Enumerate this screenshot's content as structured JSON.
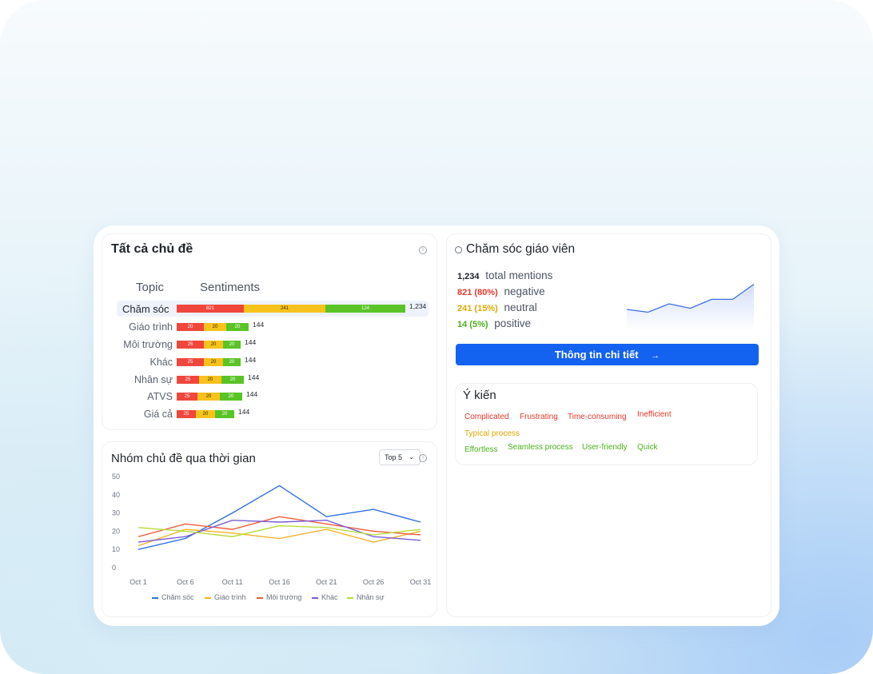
{
  "topics_card": {
    "title": "Tất cả chủ đề",
    "col_topic": "Topic",
    "col_sentiments": "Sentiments",
    "rows": [
      {
        "label": "Chăm sóc",
        "neg": "821",
        "neu": "241",
        "pos": "124",
        "total": "1,234",
        "selected": true
      },
      {
        "label": "Giáo trình",
        "neg": "20",
        "neu": "20",
        "pos": "20",
        "total": "144"
      },
      {
        "label": "Môi trường",
        "neg": "25",
        "neu": "20",
        "pos": "20",
        "total": "144"
      },
      {
        "label": "Khác",
        "neg": "25",
        "neu": "20",
        "pos": "20",
        "total": "144"
      },
      {
        "label": "Nhân sự",
        "neg": "25",
        "neu": "20",
        "pos": "20",
        "total": "144"
      },
      {
        "label": "ATVS",
        "neg": "25",
        "neu": "20",
        "pos": "20",
        "total": "144"
      },
      {
        "label": "Giá cả",
        "neg": "25",
        "neu": "20",
        "pos": "20",
        "total": "144"
      }
    ],
    "colors": {
      "negative": "#f0473c",
      "neutral": "#f8c21c",
      "positive": "#5ac427"
    }
  },
  "detail_card": {
    "title": "Chăm sóc giáo viên",
    "icon": "chat-icon",
    "total_value": "1,234",
    "total_label": "total mentions",
    "negative_value": "821 (80%)",
    "negative_label": "negative",
    "neutral_value": "241 (15%)",
    "neutral_label": "neutral",
    "positive_value": "14 (5%)",
    "positive_label": "positive",
    "button_label": "Thông tin chi tiết",
    "button_arrow": "→",
    "sparkline": [
      0.4,
      0.35,
      0.5,
      0.42,
      0.58,
      0.58,
      0.85
    ]
  },
  "opinions_card": {
    "title": "Ý kiến",
    "tags_negative": [
      "Complicated",
      "Frustrating",
      "Time-consuming",
      "Inefficient"
    ],
    "tags_neutral": [
      "Typical process"
    ],
    "tags_positive": [
      "Effortless",
      "Seamless process",
      "User-friendly",
      "Quick"
    ]
  },
  "timeline_card": {
    "title": "Nhóm chủ đề qua thời gian",
    "select_value": "Top 5",
    "select_icon": "chevron-down-icon"
  },
  "chart_data": {
    "type": "line",
    "x": [
      "Oct 1",
      "Oct 6",
      "Oct 11",
      "Oct 16",
      "Oct 21",
      "Oct 26",
      "Oct 31"
    ],
    "ylim": [
      0,
      50
    ],
    "yticks": [
      "50",
      "40",
      "30",
      "20",
      "10",
      "0"
    ],
    "series": [
      {
        "name": "Chăm sóc",
        "color": "#2f6fe0",
        "values": [
          10,
          16,
          30,
          45,
          28,
          32,
          25
        ]
      },
      {
        "name": "Giáo trình",
        "color": "#f2b42a",
        "values": [
          12,
          21,
          19,
          16,
          21,
          14,
          20
        ]
      },
      {
        "name": "Môi trường",
        "color": "#ef5b3a",
        "values": [
          17,
          24,
          21,
          28,
          24,
          20,
          18
        ]
      },
      {
        "name": "Khác",
        "color": "#7b5cd6",
        "values": [
          14,
          17,
          26,
          25,
          26,
          17,
          15
        ]
      },
      {
        "name": "Nhân sự",
        "color": "#b8dc3a",
        "values": [
          22,
          20,
          17,
          23,
          22,
          18,
          21
        ]
      }
    ]
  }
}
